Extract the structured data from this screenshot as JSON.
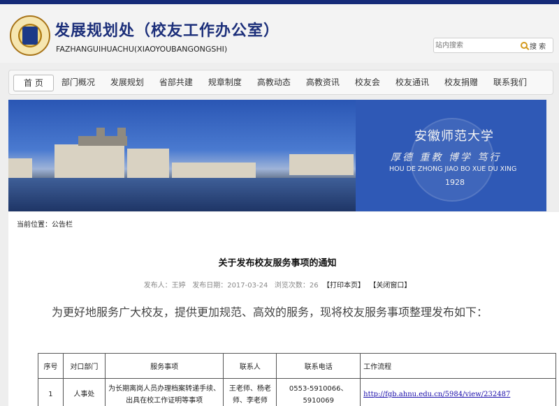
{
  "header": {
    "title": "发展规划处（校友工作办公室）",
    "subtitle": "FAZHANGUIHUACHU(XIAOYOUBANGONGSHI)",
    "search_placeholder": "站内搜索",
    "search_button": "搜 索"
  },
  "nav": {
    "items": [
      {
        "label": "首 页"
      },
      {
        "label": "部门概况"
      },
      {
        "label": "发展规划"
      },
      {
        "label": "省部共建"
      },
      {
        "label": "规章制度"
      },
      {
        "label": "高教动态"
      },
      {
        "label": "高教资讯"
      },
      {
        "label": "校友会"
      },
      {
        "label": "校友通讯"
      },
      {
        "label": "校友捐赠"
      },
      {
        "label": "联系我们"
      }
    ]
  },
  "banner": {
    "university_name": "安徽师范大学",
    "motto_cn": "厚德 重教 博学 笃行",
    "motto_pinyin": "HOU DE ZHONG JIAO    BO XUE DU XING",
    "year": "1928"
  },
  "breadcrumb": "当前位置：公告栏",
  "article": {
    "title": "关于发布校友服务事项的通知",
    "publisher": "发布人：王婷",
    "date": "发布日期：2017-03-24",
    "views": "浏览次数：26",
    "print_link": "【打印本页】",
    "close_link": "【关闭窗口】",
    "intro": "为更好地服务广大校友，提供更加规范、高效的服务，现将校友服务事项整理发布如下："
  },
  "table": {
    "headers": [
      "序号",
      "对口部门",
      "服务事项",
      "联系人",
      "联系电话",
      "工作流程"
    ],
    "rows": [
      {
        "no": "1",
        "dept": "人事处",
        "service": "为长期离岗人员办理档案转递手续、出具在校工作证明等事项",
        "contact": "王老师、杨老师、李老师",
        "phone": "0553-5910066、5910069",
        "flow": "http://fgb.ahnu.edu.cn/5984/view/232487"
      }
    ]
  }
}
